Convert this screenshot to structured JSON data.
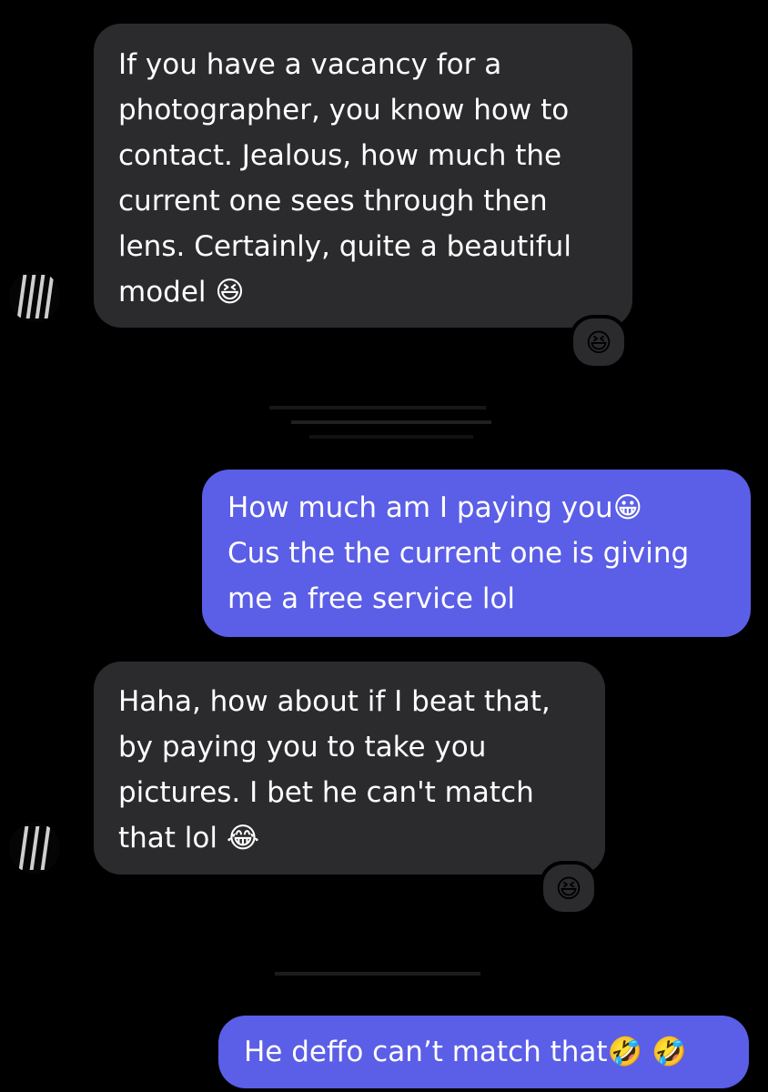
{
  "messages": [
    {
      "id": "m1",
      "direction": "incoming",
      "lines": [
        "If you have a vacancy for a",
        "photographer, you know how to",
        "contact. Jealous, how much the",
        "current one sees through then",
        "lens. Certainly, quite a beautiful",
        "model 😆"
      ],
      "reaction": "😆"
    },
    {
      "id": "m2",
      "direction": "outgoing",
      "lines": [
        "How much am I paying you😀",
        "Cus the the current one is giving",
        "me a free service lol"
      ]
    },
    {
      "id": "m3",
      "direction": "incoming",
      "lines": [
        "Haha, how about if I beat that,",
        "by paying you to take you",
        "pictures. I bet he can't match",
        "that lol 😂"
      ],
      "reaction": "😆"
    },
    {
      "id": "m4",
      "direction": "outgoing",
      "lines": [
        "He deffo can’t match that🤣 🤣"
      ]
    }
  ],
  "colors": {
    "background": "#000000",
    "incoming_bubble": "#2b2b2d",
    "outgoing_bubble": "#5b5ee6",
    "text": "#ffffff"
  }
}
